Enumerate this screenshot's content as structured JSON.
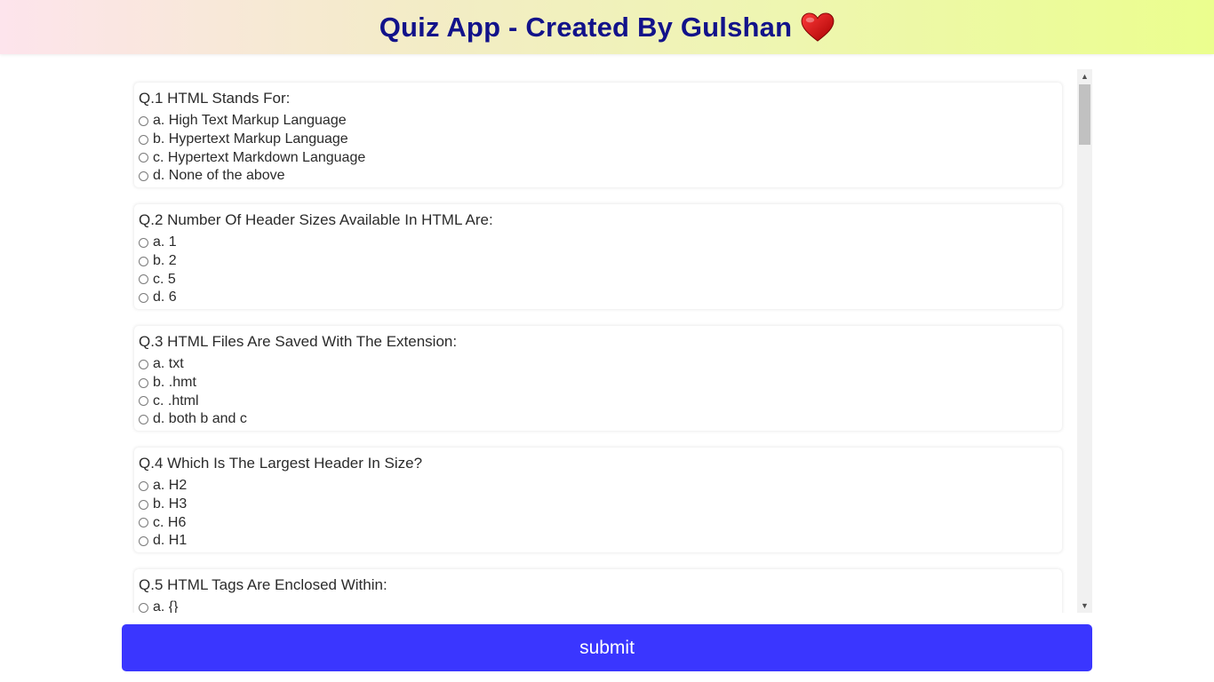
{
  "header": {
    "title": "Quiz App - Created By Gulshan",
    "icon": "heart-icon",
    "title_color": "#12128a"
  },
  "questions": [
    {
      "text": "Q.1 HTML Stands For:",
      "options": [
        "a. High Text Markup Language",
        "b. Hypertext Markup Language",
        "c. Hypertext Markdown Language",
        "d. None of the above"
      ]
    },
    {
      "text": "Q.2 Number Of Header Sizes Available In HTML Are:",
      "options": [
        "a. 1",
        "b. 2",
        "c. 5",
        "d. 6"
      ]
    },
    {
      "text": "Q.3 HTML Files Are Saved With The Extension:",
      "options": [
        "a. txt",
        "b. .hmt",
        "c. .html",
        "d. both b and c"
      ]
    },
    {
      "text": "Q.4 Which Is The Largest Header In Size?",
      "options": [
        "a. H2",
        "b. H3",
        "c. H6",
        "d. H1"
      ]
    },
    {
      "text": "Q.5 HTML Tags Are Enclosed Within:",
      "options": [
        "a. {}"
      ]
    }
  ],
  "footer": {
    "submit_label": "submit",
    "button_color": "#3a36ff"
  }
}
